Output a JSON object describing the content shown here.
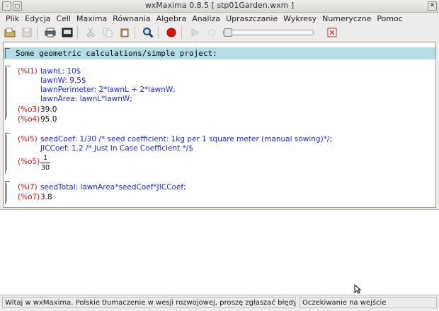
{
  "window": {
    "title": "wxMaxima 0.8.5  [ stp01Garden.wxm ]"
  },
  "menu": [
    "Plik",
    "Edycja",
    "Cell",
    "Maxima",
    "Równania",
    "Algebra",
    "Analiza",
    "Upraszczanie",
    "Wykresy",
    "Numeryczne",
    "Pomoc"
  ],
  "toolbar": {
    "icons": [
      "open-icon",
      "save-icon",
      "print-icon",
      "config-icon",
      "cut-icon",
      "copy-icon",
      "paste-icon",
      "find-icon",
      "interrupt-icon",
      "play-icon",
      "stop-icon",
      "animation-slider",
      "close-icon"
    ]
  },
  "worksheet": {
    "title_cell": "Some geometric calculations/simple project:",
    "cell1": {
      "in_label": "(%i1)",
      "lines": [
        "lawnL: 10$",
        "lawnW: 9.5$",
        "lawnPerimeter: 2*lawnL + 2*lawnW;",
        "lawnArea: lawnL*lawnW;"
      ],
      "out1_label": "(%o3)",
      "out1_value": "39.0",
      "out2_label": "(%o4)",
      "out2_value": "95.0"
    },
    "cell2": {
      "in_label": "(%i5)",
      "lines": [
        "seedCoef: 1/30 /* seed coefficient: 1kg per 1 square meter (manual sowing)*/;",
        "JICCoef: 1.2 /* Just In Case Coefficient */$"
      ],
      "out_label": "(%o5)",
      "out_num": "1",
      "out_den": "30"
    },
    "cell3": {
      "in_label": "(%i7)",
      "line": "seedTotal: lawnArea*seedCoef*JICCoef;",
      "out_label": "(%o7)",
      "out_value": "3.8"
    }
  },
  "status": {
    "left": "Witaj w wxMaxima. Polskie tłumaczenie w wesji rozwojowej, proszę zgłaszać błędy.",
    "right": "Oczekiwanie na wejście"
  },
  "colors": {
    "title_cell_bg": "#b5dde7",
    "input_text": "#1e2bd6",
    "label_text": "#c81818"
  }
}
